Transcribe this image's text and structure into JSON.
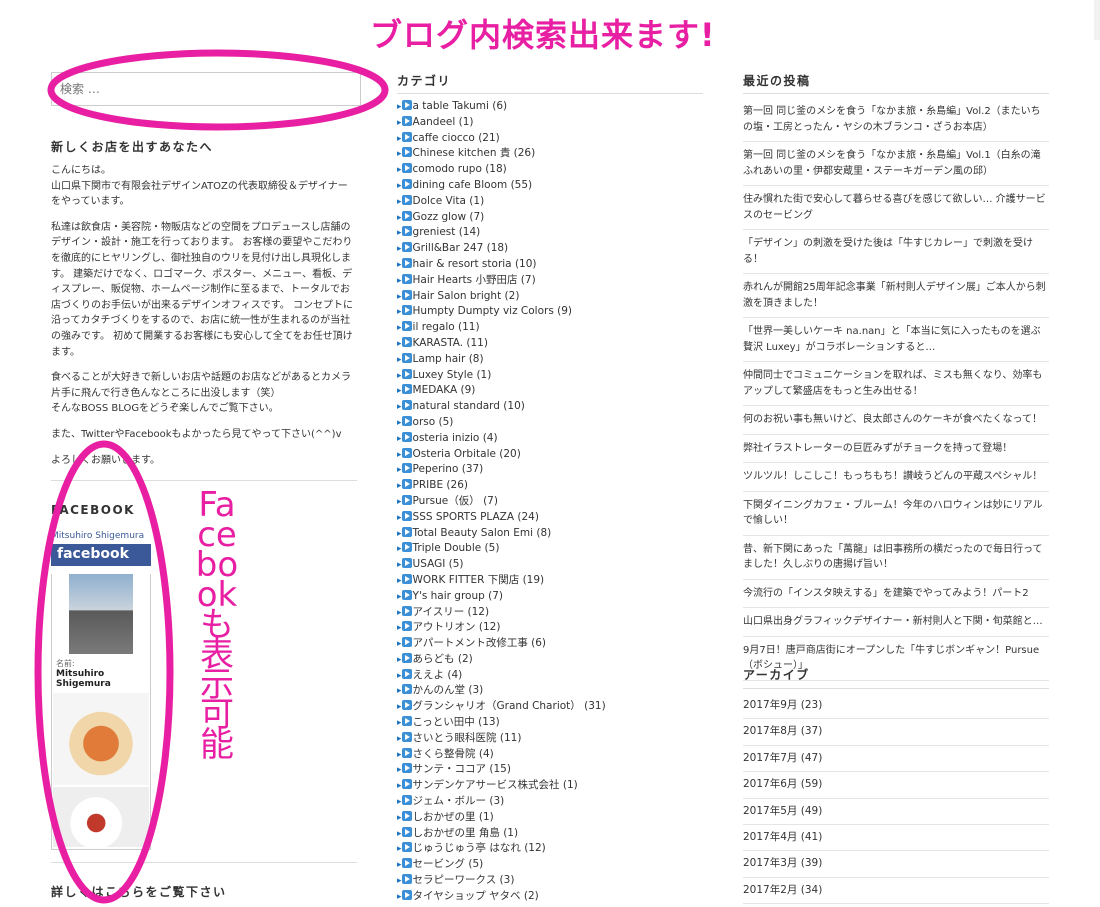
{
  "annotations": {
    "top": "ブログ内検索出来ます!",
    "side": "Facebookも表示可能"
  },
  "search": {
    "placeholder": "検索 …"
  },
  "intro": {
    "title": "新しくお店を出すあなたへ",
    "paragraphs": [
      "こんにちは。\n山口県下関市で有限会社デザインATOZの代表取締役＆デザイナーをやっています。",
      "私達は飲食店・美容院・物販店などの空間をプロデュースし店舗のデザイン・設計・施工を行っております。 お客様の要望やこだわりを徹底的にヒヤリングし、御社独自のウリを見付け出し具現化します。 建築だけでなく、ロゴマーク、ポスター、メニュー、看板、ディスプレー、販促物、ホームページ制作に至るまで、トータルでお店づくりのお手伝いが出来るデザインオフィスです。 コンセプトに沿ってカタチづくりをするので、お店に統一性が生まれるのが当社の強みです。 初めて開業するお客様にも安心して全てをお任せ頂けます。",
      "食べることが大好きで新しいお店や話題のお店などがあるとカメラ片手に飛んで行き色んなところに出没します（笑）\nそんなBOSS BLOGをどうぞ楽しんでご覧下さい。",
      "また、TwitterやFacebookもよかったら見てやって下さい(^^)v",
      "よろしくお願いします。"
    ]
  },
  "facebook": {
    "title": "FACEBOOK",
    "page_name": "Mitsuhiro Shigemura",
    "brand": "facebook",
    "name_label": "名前:",
    "name_value": "Mitsuhiro Shigemura"
  },
  "detail_title": "詳しくはこちらをご覧下さい",
  "categories": {
    "title": "カテゴリ",
    "items": [
      "a table Takumi (6)",
      "Aandeel (1)",
      "caffe ciocco (21)",
      "Chinese kitchen 貴 (26)",
      "comodo rupo (18)",
      "dining cafe Bloom (55)",
      "Dolce Vita (1)",
      "Gozz glow (7)",
      "greniest (14)",
      "Grill&Bar 247 (18)",
      "hair & resort storia (10)",
      "Hair Hearts 小野田店 (7)",
      "Hair Salon bright (2)",
      "Humpty Dumpty viz Colors (9)",
      "il regalo (11)",
      "KARASTA. (11)",
      "Lamp hair (8)",
      "Luxey Style (1)",
      "MEDAKA (9)",
      "natural standard (10)",
      "orso (5)",
      "osteria inizio (4)",
      "Osteria Orbitale (20)",
      "Peperino (37)",
      "PRIBE (26)",
      "Pursue（仮） (7)",
      "SSS SPORTS PLAZA (24)",
      "Total Beauty Salon Emi (8)",
      "Triple Double (5)",
      "USAGI (5)",
      "WORK FITTER 下関店 (19)",
      "Y's hair group (7)",
      "アイスリー (12)",
      "アウトリオン (12)",
      "アパートメント改修工事 (6)",
      "あらども (2)",
      "ええよ (4)",
      "かんのん堂 (3)",
      "グランシャリオ（Grand Chariot） (31)",
      "こっとい田中 (13)",
      "さいとう眼科医院 (11)",
      "さくら整骨院 (4)",
      "サンテ・ココア (15)",
      "サンデンケアサービス株式会社 (1)",
      "ジェム・ボルー (3)",
      "しおかぜの里 (1)",
      "しおかぜの里 角島 (1)",
      "じゅうじゅう亭 はなれ (12)",
      "セービング (5)",
      "セラピーワークス (3)",
      "タイヤショップ ヤタベ (2)"
    ]
  },
  "recent": {
    "title": "最近の投稿",
    "items": [
      "第一回 同じ釜のメシを食う「なかま旅・糸島編」Vol.2（またいちの塩・工房とったん・ヤシの木ブランコ・ざうお本店）",
      "第一回 同じ釜のメシを食う「なかま旅・糸島編」Vol.1（白糸の滝ふれあいの里・伊都安蔵里・ステーキガーデン風の邱）",
      "住み慣れた街で安心して暮らせる喜びを感じて欲しい… 介護サービスのセービング",
      "「デザイン」の刺激を受けた後は「牛すじカレー」で刺激を受ける！",
      "赤れんが開館25周年記念事業「新村則人デザイン展」ご本人から刺激を頂きました！",
      "「世界一美しいケーキ na.nan」と「本当に気に入ったものを選ぶ贅沢 Luxey」がコラボレーションすると…",
      "仲間同士でコミュニケーションを取れば、ミスも無くなり、効率もアップして繁盛店をもっと生み出せる！",
      "何のお祝い事も無いけど、良太郎さんのケーキが食べたくなって！",
      "弊社イラストレーターの巨匠みずがチョークを持って登場！",
      "ツルツル！しこしこ！もっちもち！讃岐うどんの平蔵スペシャル！",
      "下関ダイニングカフェ・ブルーム！今年のハロウィンは妙にリアルで愉しい！",
      "昔、新下関にあった「萬龍」は旧事務所の横だったので毎日行ってました！久しぶりの唐揚げ旨い！",
      "今流行の「インスタ映えする」を建築でやってみよう！パート2",
      "山口県出身グラフィックデザイナー・新村則人と下関・旬菜館と…",
      "9月7日！唐戸商店街にオープンした「牛すじボンギャン！Pursue（ボシュー）」"
    ]
  },
  "archive": {
    "title": "アーカイブ",
    "items": [
      "2017年9月 (23)",
      "2017年8月 (37)",
      "2017年7月 (47)",
      "2017年6月 (59)",
      "2017年5月 (49)",
      "2017年4月 (41)",
      "2017年3月 (39)",
      "2017年2月 (34)"
    ]
  },
  "colors": {
    "annotation": "#e81fa3",
    "link_icon": "#3b8fd6",
    "facebook": "#3b5998"
  }
}
